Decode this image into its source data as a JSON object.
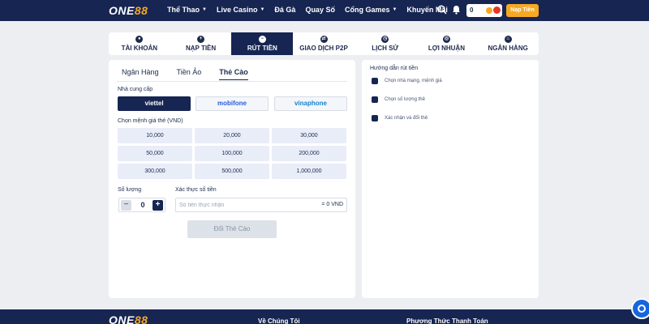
{
  "header": {
    "logo_main": "ONE",
    "logo_accent": "88",
    "nav": [
      "Thể Thao",
      "Live Casino",
      "Đá Gà",
      "Quay Số",
      "Cổng Games",
      "Khuyến Mãi"
    ],
    "balance": "0",
    "deposit_label": "Nạp Tiền"
  },
  "tabs": [
    {
      "label": "TÀI KHOẢN",
      "icon": "user-icon"
    },
    {
      "label": "NẠP TIỀN",
      "icon": "plus-icon"
    },
    {
      "label": "RÚT TIỀN",
      "icon": "minus-icon"
    },
    {
      "label": "GIAO DỊCH P2P",
      "icon": "exchange-icon"
    },
    {
      "label": "LỊCH SỬ",
      "icon": "clock-icon"
    },
    {
      "label": "LỢI NHUẬN",
      "icon": "globe-icon"
    },
    {
      "label": "NGÂN HÀNG",
      "icon": "bank-icon"
    }
  ],
  "withdraw": {
    "subtabs": [
      "Ngân Hàng",
      "Tiền Ảo",
      "Thẻ Cào"
    ],
    "provider_label": "Nhà cung cấp",
    "providers": [
      "viettel",
      "mobifone",
      "vinaphone"
    ],
    "denom_label": "Chọn mệnh giá thẻ (VND)",
    "denoms": [
      "10,000",
      "20,000",
      "30,000",
      "50,000",
      "100,000",
      "200,000",
      "300,000",
      "500,000",
      "1,000,000"
    ],
    "quantity_label": "Số lượng",
    "quantity_value": "0",
    "amount_label": "Xác thực số tiền",
    "amount_placeholder": "Số tiền thực nhận",
    "amount_suffix": "= 0 VND",
    "submit_label": "Đổi Thẻ Cào"
  },
  "guide": {
    "title": "Hướng dẫn rút tiền",
    "steps": [
      "Chọn nhà mạng, mệnh giá",
      "Chọn số lượng thẻ",
      "Xác nhận và đổi thẻ"
    ]
  },
  "footer": {
    "logo_main": "ONE",
    "logo_accent": "88",
    "about_label": "Về Chúng Tôi",
    "payment_label": "Phương Thức Thanh Toán"
  }
}
